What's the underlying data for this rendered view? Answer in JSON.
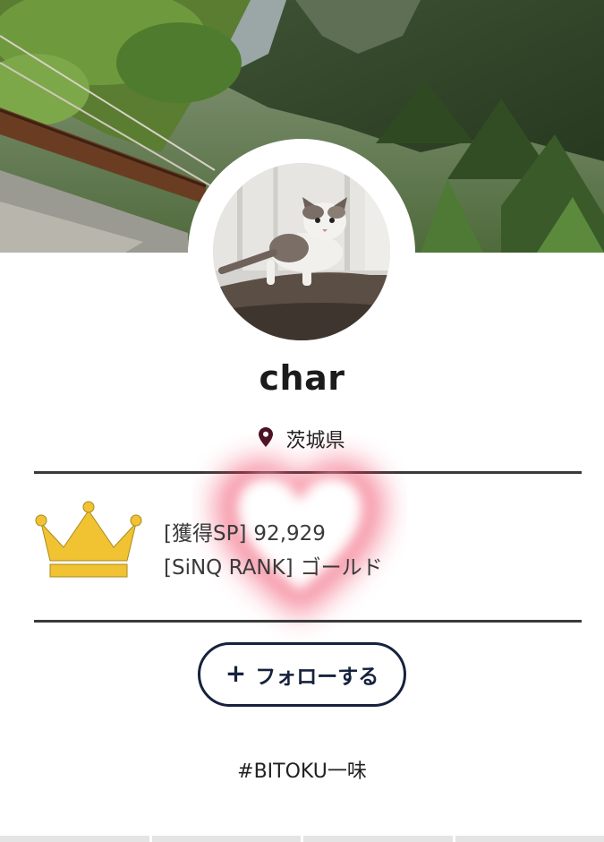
{
  "profile": {
    "name": "char",
    "location": "茨城県"
  },
  "icons": {
    "location": "map-pin-icon",
    "rank": "crown-icon",
    "decoration": "heart-icon"
  },
  "stats": {
    "sp_label": "[獲得SP]",
    "sp_value": "92,929",
    "rank_label": "[SiNQ RANK]",
    "rank_value": "ゴールド"
  },
  "follow": {
    "plus": "+",
    "label": "フォローする"
  },
  "hashtag": "#BITOKU一味",
  "colors": {
    "button_border": "#16223d",
    "crown": "#f1c232",
    "location_pin": "#4a1424",
    "heart_glow": "#ee3353"
  }
}
